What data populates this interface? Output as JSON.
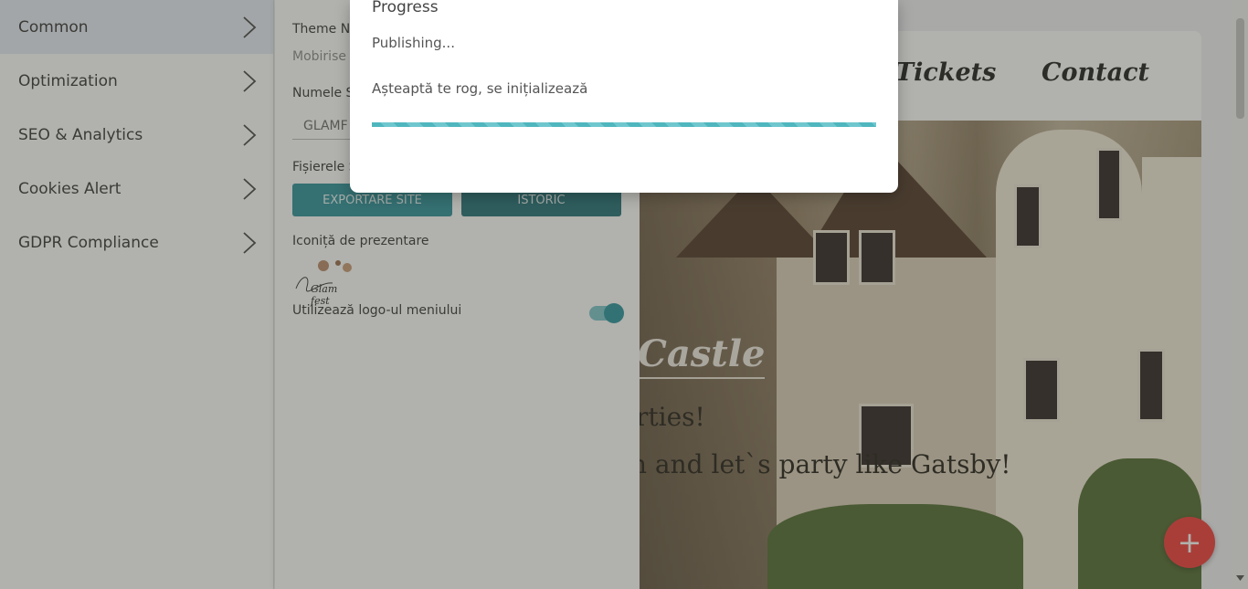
{
  "sidebar": {
    "items": [
      {
        "label": "Common",
        "active": true
      },
      {
        "label": "Optimization"
      },
      {
        "label": "SEO & Analytics"
      },
      {
        "label": "Cookies Alert"
      },
      {
        "label": "GDPR Compliance"
      }
    ]
  },
  "panel": {
    "theme_label": "Theme Na",
    "theme_value": "Mobirise",
    "site_name_label": "Numele S",
    "site_name_value": "GLAMF",
    "files_label": "Fișierele S",
    "export_button": "EXPORTARE SITE",
    "history_button": "ISTORIC",
    "favicon_label": "Iconiță de prezentare",
    "favicon_logo_text": "Glam fest",
    "menu_logo_label": "Utilizează logo-ul meniului",
    "menu_logo_enabled": true
  },
  "preview": {
    "nav_links": [
      "Tickets",
      "Contact"
    ],
    "hero_title": "Castle",
    "hero_line1": "rties!",
    "hero_line2": "n and let`s party like Gatsby!",
    "fab_icon": "plus-icon"
  },
  "modal": {
    "title": "Progress",
    "status": "Publishing...",
    "message": "Așteaptă te rog, se inițializează"
  },
  "colors": {
    "accent": "#2a8f9a",
    "fab": "#f23a37"
  }
}
